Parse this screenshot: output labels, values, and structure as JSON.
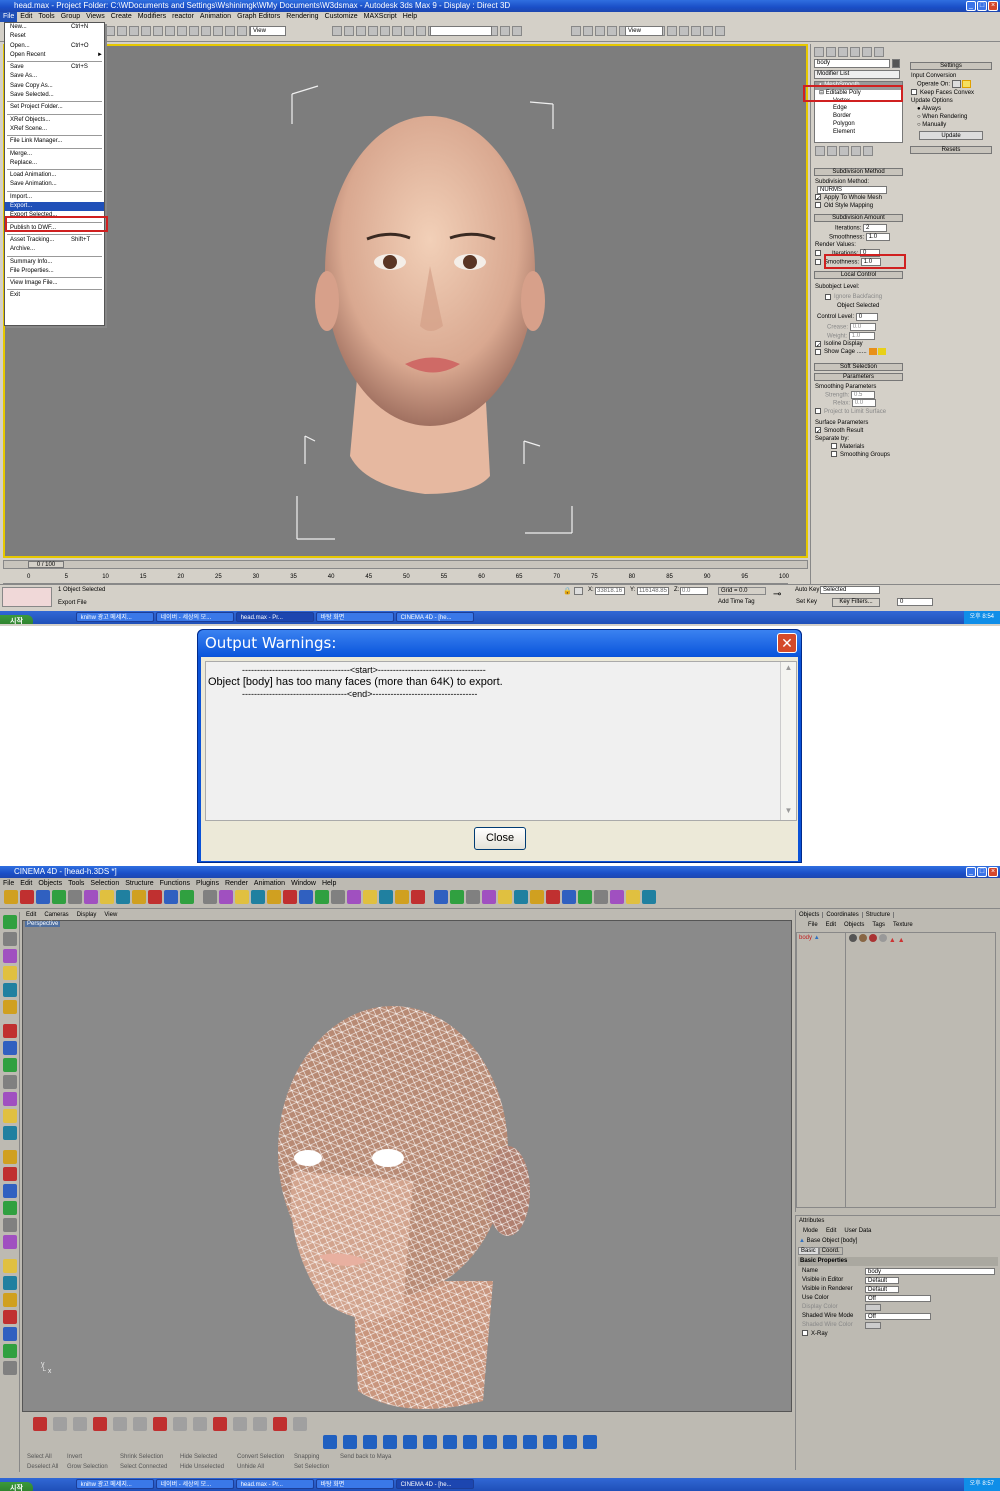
{
  "max": {
    "title": "head.max   - Project Folder: C:\\WDocuments and Settings\\Wshinimgk\\WMy Documents\\W3dsmax   - Autodesk 3ds Max 9   - Display : Direct 3D",
    "menu": [
      "File",
      "Edit",
      "Tools",
      "Group",
      "Views",
      "Create",
      "Modifiers",
      "reactor",
      "Animation",
      "Graph Editors",
      "Rendering",
      "Customize",
      "MAXScript",
      "Help"
    ],
    "view_dropdown_1": "View",
    "view_dropdown_2": "View",
    "file_menu": [
      {
        "label": "New...",
        "shortcut": "Ctrl+N"
      },
      {
        "label": "Reset",
        "shortcut": ""
      },
      {
        "label": "Open...",
        "shortcut": "Ctrl+O"
      },
      {
        "label": "Open Recent",
        "shortcut": "►"
      },
      {
        "sep": true
      },
      {
        "label": "Save",
        "shortcut": "Ctrl+S"
      },
      {
        "label": "Save As...",
        "shortcut": ""
      },
      {
        "label": "Save Copy As...",
        "shortcut": ""
      },
      {
        "label": "Save Selected...",
        "shortcut": ""
      },
      {
        "sep": true
      },
      {
        "label": "Set Project Folder...",
        "shortcut": ""
      },
      {
        "sep": true
      },
      {
        "label": "XRef Objects...",
        "shortcut": ""
      },
      {
        "label": "XRef Scene...",
        "shortcut": ""
      },
      {
        "sep": true
      },
      {
        "label": "File Link Manager...",
        "shortcut": ""
      },
      {
        "sep": true
      },
      {
        "label": "Merge...",
        "shortcut": ""
      },
      {
        "label": "Replace...",
        "shortcut": ""
      },
      {
        "sep": true
      },
      {
        "label": "Load Animation...",
        "shortcut": ""
      },
      {
        "label": "Save Animation...",
        "shortcut": ""
      },
      {
        "sep": true
      },
      {
        "label": "Import...",
        "shortcut": ""
      },
      {
        "label": "Export...",
        "shortcut": "",
        "selected": true
      },
      {
        "label": "Export Selected...",
        "shortcut": ""
      },
      {
        "sep": true
      },
      {
        "label": "Publish to DWF...",
        "shortcut": ""
      },
      {
        "sep": true
      },
      {
        "label": "Asset Tracking...",
        "shortcut": "Shift+T"
      },
      {
        "label": "Archive...",
        "shortcut": ""
      },
      {
        "sep": true
      },
      {
        "label": "Summary Info...",
        "shortcut": ""
      },
      {
        "label": "File Properties...",
        "shortcut": ""
      },
      {
        "sep": true
      },
      {
        "label": "View Image File...",
        "shortcut": ""
      },
      {
        "sep": true
      },
      {
        "label": "Exit",
        "shortcut": ""
      }
    ],
    "cmd": {
      "object_name": "body",
      "modifier_list": "Modifier List",
      "stack": [
        "MeshSmooth",
        "Editable Poly",
        "Vertex",
        "Edge",
        "Border",
        "Polygon",
        "Element"
      ],
      "subdiv_method_head": "Subdivision Method",
      "subdiv_method_label": "Subdivision Method:",
      "subdiv_method_value": "NURMS",
      "apply_whole": "Apply To Whole Mesh",
      "old_style": "Old Style Mapping",
      "subdiv_amount_head": "Subdivision Amount",
      "iterations_label": "Iterations:",
      "iterations_value": "2",
      "smoothness_label": "Smoothness:",
      "smoothness_value": "1.0",
      "render_values": "Render Values:",
      "r_iterations": "Iterations:",
      "r_iterations_value": "0",
      "r_smoothness": "Smoothness:",
      "r_smoothness_value": "1.0",
      "local_control_head": "Local Control",
      "sublevel": "Subobject Level:",
      "ignore_backfacing": "Ignore Backfacing",
      "object_selected": "Object Selected",
      "control_level": "Control Level:",
      "control_level_value": "0",
      "crease": "Crease:",
      "crease_value": "0.0",
      "weight": "Weight:",
      "weight_value": "1.0",
      "isoline": "Isoline Display",
      "show_cage": "Show Cage ......",
      "soft_sel_head": "Soft Selection",
      "params_head": "Parameters",
      "smoothing_params": "Smoothing Parameters",
      "strength": "Strength:",
      "strength_value": "0.5",
      "relax": "Relax:",
      "relax_value": "0.0",
      "project_limit": "Project to Limit Surface",
      "surface_params": "Surface Parameters",
      "smooth_result": "Smooth Result",
      "separate_by": "Separate by:",
      "materials": "Materials",
      "smoothing_groups": "Smoothing Groups"
    },
    "settings": {
      "head": "Settings",
      "input_conversion": "Input Conversion",
      "operate_on": "Operate On:",
      "keep_faces": "Keep Faces Convex",
      "update_options": "Update Options",
      "always": "Always",
      "when_rendering": "When Rendering",
      "manually": "Manually",
      "update": "Update",
      "resets": "Resets"
    },
    "timeline": {
      "frame_label": "0 / 100",
      "ticks": [
        "0",
        "5",
        "10",
        "15",
        "20",
        "25",
        "30",
        "35",
        "40",
        "45",
        "50",
        "55",
        "60",
        "65",
        "70",
        "75",
        "80",
        "85",
        "90",
        "95",
        "100"
      ]
    },
    "status": {
      "selected": "1 Object Selected",
      "export_file": "Export File",
      "x_label": "X:",
      "x_value": "33818.16",
      "y_label": "Y:",
      "y_value": "116148.85",
      "z_label": "Z:",
      "z_value": "0.0",
      "grid": "Grid = 0.0",
      "add_time_tag": "Add Time Tag",
      "auto_key": "Auto Key",
      "selected_dd": "Selected",
      "set_key": "Set Key",
      "key_filters": "Key Filters...",
      "frame_value": "0"
    },
    "taskbar": {
      "start": "시작",
      "tasks": [
        "knihw 광고 메세지...",
        "네이버 - 세상의 모...",
        "head.max - Pr...",
        "바탕 화면",
        "CINEMA 4D - [he..."
      ],
      "clock": "오후 8:54"
    }
  },
  "dialog": {
    "title": "Output Warnings:",
    "line_start": "------------------------------------<start>------------------------------------",
    "message": "Object [body] has too many faces (more than 64K) to export.",
    "line_end": "-----------------------------------<end>-----------------------------------",
    "close": "Close"
  },
  "c4d": {
    "title": "CINEMA 4D - [head-h.3DS *]",
    "menu": [
      "File",
      "Edit",
      "Objects",
      "Tools",
      "Selection",
      "Structure",
      "Functions",
      "Plugins",
      "Render",
      "Animation",
      "Window",
      "Help"
    ],
    "viewport_menu": [
      "Edit",
      "Cameras",
      "Display",
      "View"
    ],
    "viewport_label": "Perspective",
    "obj_tabs": [
      "Objects",
      "Coordinates",
      "Structure"
    ],
    "obj_menu": [
      "File",
      "Edit",
      "Objects",
      "Tags",
      "Texture"
    ],
    "obj_item": "body",
    "attr_tab": "Attributes",
    "attr_menu": [
      "Mode",
      "Edit",
      "User Data"
    ],
    "attr_obj": "Base Object [body]",
    "attr_subtabs": [
      "Basic",
      "Coord."
    ],
    "basic_props": "Basic Properties",
    "props": [
      {
        "label": "Name",
        "value": "body"
      },
      {
        "label": "Visible in Editor",
        "value": "Default"
      },
      {
        "label": "Visible in Renderer",
        "value": "Default"
      },
      {
        "label": "Use Color",
        "value": "Off"
      },
      {
        "label": "Display Color",
        "value": ""
      },
      {
        "label": "Shaded Wire Mode",
        "value": "Off"
      },
      {
        "label": "Shaded Wire Color",
        "value": ""
      }
    ],
    "xray": "X-Ray",
    "bottom_labels": [
      "Select All",
      "Invert",
      "Shrink Selection",
      "Hide Selected",
      "Convert Selection",
      "Snapping",
      "Send back to Maya",
      "Deselect All",
      "Grow Selection",
      "Select Connected",
      "Hide Unselected",
      "Unhide All",
      "Set Selection"
    ],
    "taskbar": {
      "start": "시작",
      "tasks": [
        "knihw 광고 메세지...",
        "네이버 - 세상의 모...",
        "head.max - Pr...",
        "바탕 화면",
        "CINEMA 4D - [he..."
      ],
      "clock": "오후 8:57"
    }
  }
}
